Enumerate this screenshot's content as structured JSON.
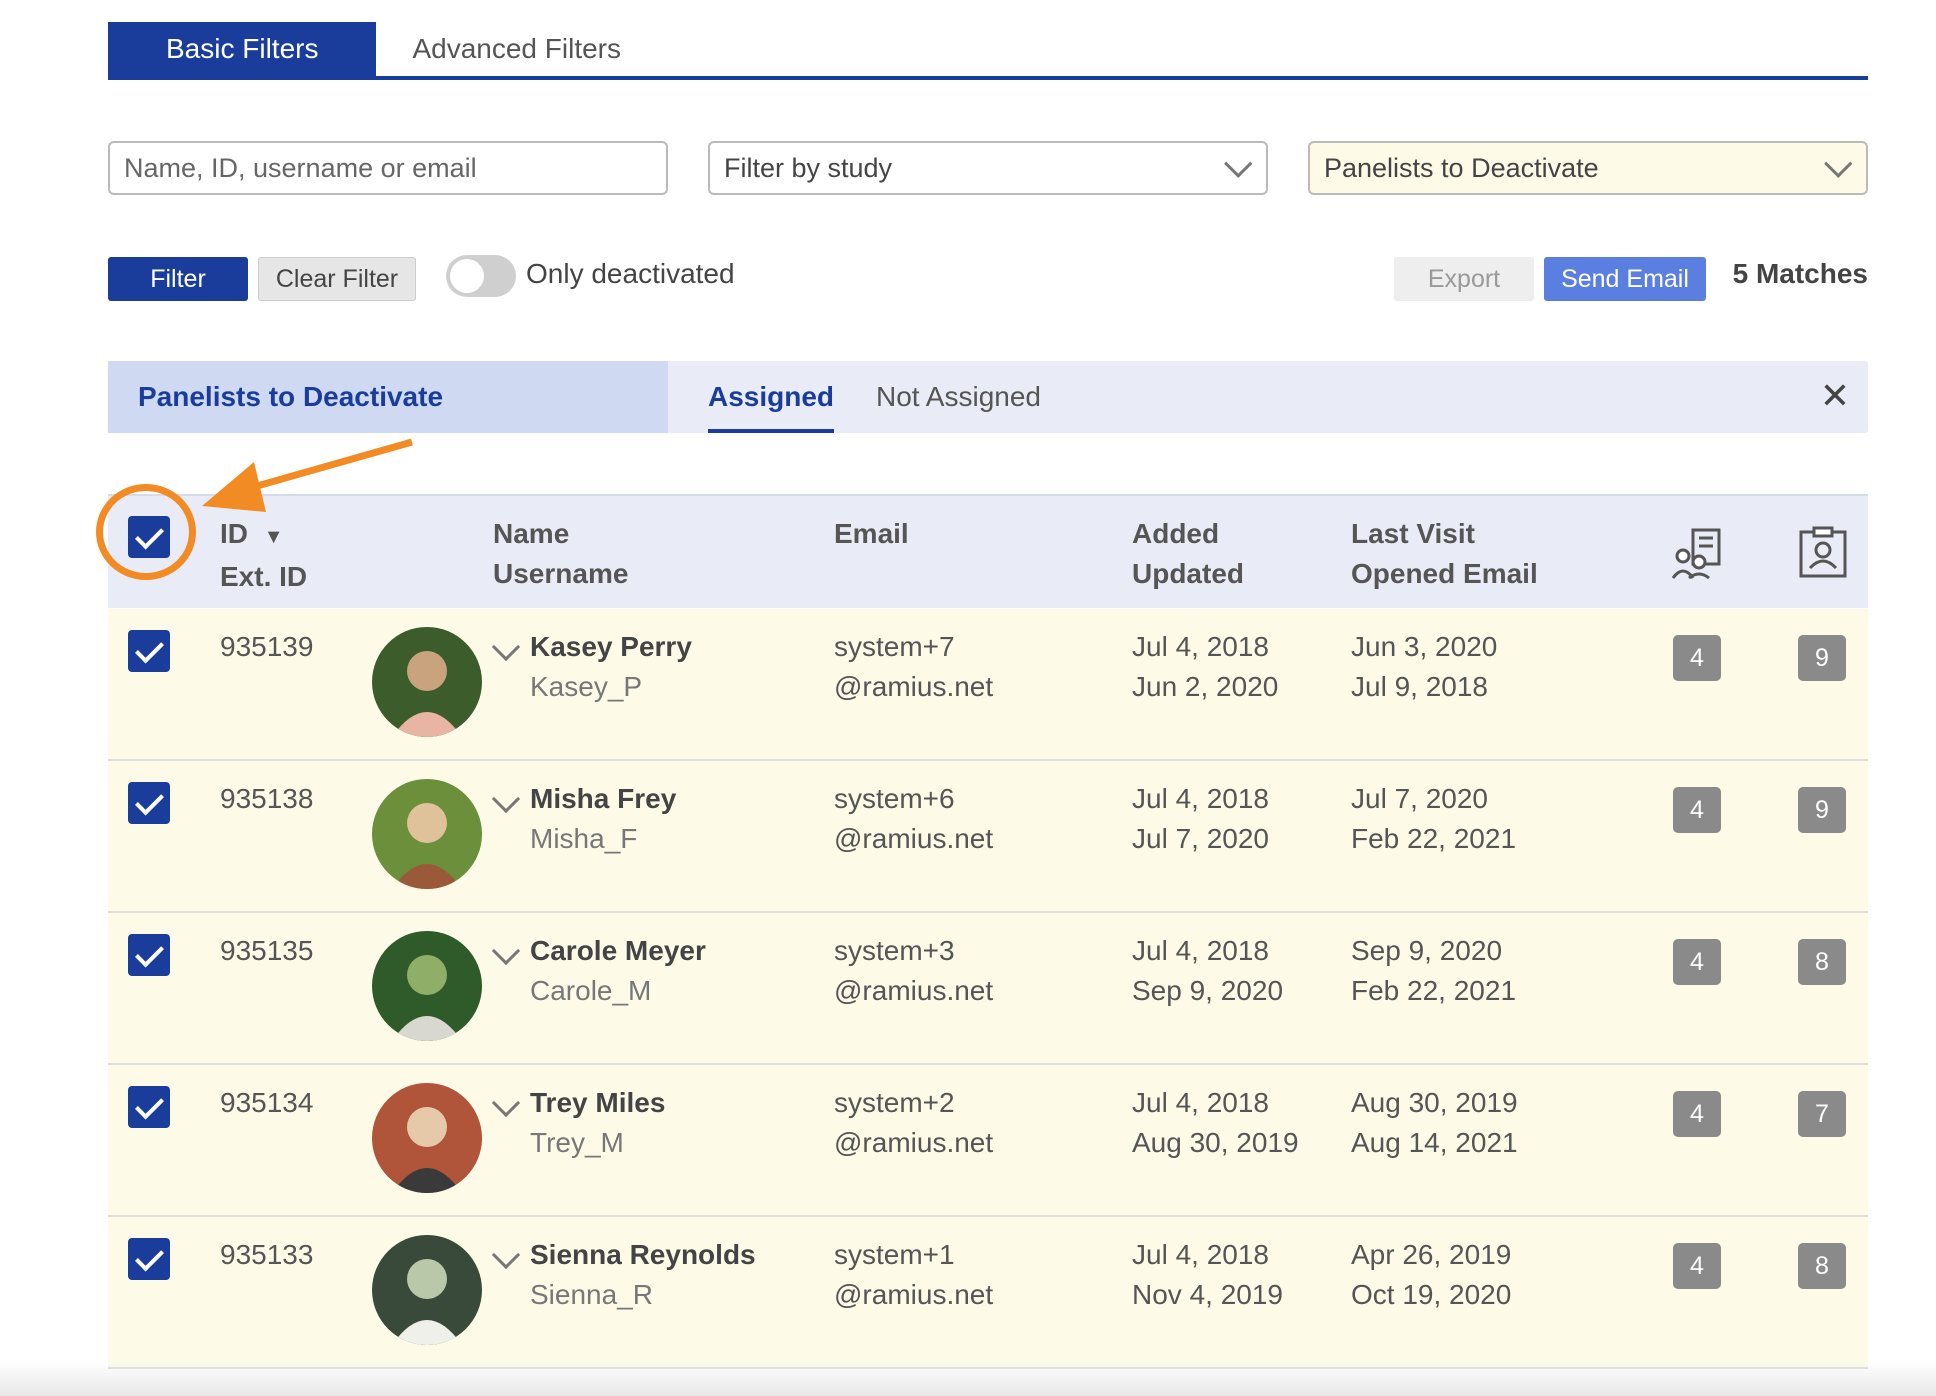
{
  "tabs": {
    "basic": "Basic Filters",
    "advanced": "Advanced Filters"
  },
  "filters": {
    "search_placeholder": "Name, ID, username or email",
    "study": "Filter by study",
    "list": "Panelists to Deactivate"
  },
  "actions": {
    "filter": "Filter",
    "clear": "Clear Filter",
    "toggle_label": "Only deactivated",
    "export": "Export",
    "send_email": "Send Email",
    "matches": "5 Matches"
  },
  "group": {
    "title": "Panelists to Deactivate",
    "assigned": "Assigned",
    "not_assigned": "Not Assigned",
    "close": "✕"
  },
  "table": {
    "headers": {
      "id": "ID",
      "ext_id": "Ext. ID",
      "name": "Name",
      "username": "Username",
      "email": "Email",
      "added": "Added",
      "updated": "Updated",
      "last_visit": "Last Visit",
      "opened_email": "Opened Email"
    },
    "rows": [
      {
        "id": "935139",
        "name": "Kasey Perry",
        "username": "Kasey_P",
        "email1": "system+7",
        "email2": "@ramius.net",
        "added": "Jul 4, 2018",
        "updated": "Jun 2, 2020",
        "last_visit": "Jun 3, 2020",
        "opened": "Jul 9, 2018",
        "b1": "4",
        "b2": "9"
      },
      {
        "id": "935138",
        "name": "Misha Frey",
        "username": "Misha_F",
        "email1": "system+6",
        "email2": "@ramius.net",
        "added": "Jul 4, 2018",
        "updated": "Jul 7, 2020",
        "last_visit": "Jul 7, 2020",
        "opened": "Feb 22, 2021",
        "b1": "4",
        "b2": "9"
      },
      {
        "id": "935135",
        "name": "Carole Meyer",
        "username": "Carole_M",
        "email1": "system+3",
        "email2": "@ramius.net",
        "added": "Jul 4, 2018",
        "updated": "Sep 9, 2020",
        "last_visit": "Sep 9, 2020",
        "opened": "Feb 22, 2021",
        "b1": "4",
        "b2": "8"
      },
      {
        "id": "935134",
        "name": "Trey Miles",
        "username": "Trey_M",
        "email1": "system+2",
        "email2": "@ramius.net",
        "added": "Jul 4, 2018",
        "updated": "Aug 30, 2019",
        "last_visit": "Aug 30, 2019",
        "opened": "Aug 14, 2021",
        "b1": "4",
        "b2": "7"
      },
      {
        "id": "935133",
        "name": "Sienna Reynolds",
        "username": "Sienna_R",
        "email1": "system+1",
        "email2": "@ramius.net",
        "added": "Jul 4, 2018",
        "updated": "Nov 4, 2019",
        "last_visit": "Apr 26, 2019",
        "opened": "Oct 19, 2020",
        "b1": "4",
        "b2": "8"
      }
    ]
  },
  "colors": {
    "primary": "#1a3d9c",
    "row_bg": "#fdfbe8",
    "annotation": "#f28b24"
  }
}
